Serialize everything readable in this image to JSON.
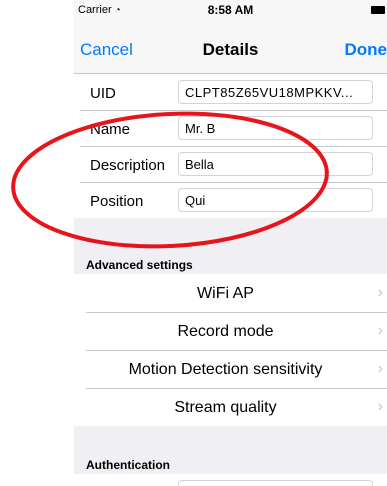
{
  "status_bar": {
    "carrier": "Carrier",
    "time": "8:58 AM"
  },
  "nav": {
    "cancel_label": "Cancel",
    "title": "Details",
    "done_label": "Done"
  },
  "fields": [
    {
      "label": "UID",
      "value": "CLPT85Z65VU18MPKKV..."
    },
    {
      "label": "Name",
      "value": "Mr. B"
    },
    {
      "label": "Description",
      "value": "Bella"
    },
    {
      "label": "Position",
      "value": "Qui"
    }
  ],
  "sections": {
    "advanced": "Advanced settings",
    "authentication": "Authentication"
  },
  "advanced_items": [
    {
      "label": "WiFi AP"
    },
    {
      "label": "Record mode"
    },
    {
      "label": "Motion Detection sensitivity"
    },
    {
      "label": "Stream quality"
    }
  ],
  "colors": {
    "accent": "#007aff",
    "annotation": "#e8141c",
    "background": "#efeff4"
  },
  "icons": {
    "wifi": "wifi-icon",
    "battery": "battery-icon",
    "chevron": "chevron-right-icon"
  }
}
